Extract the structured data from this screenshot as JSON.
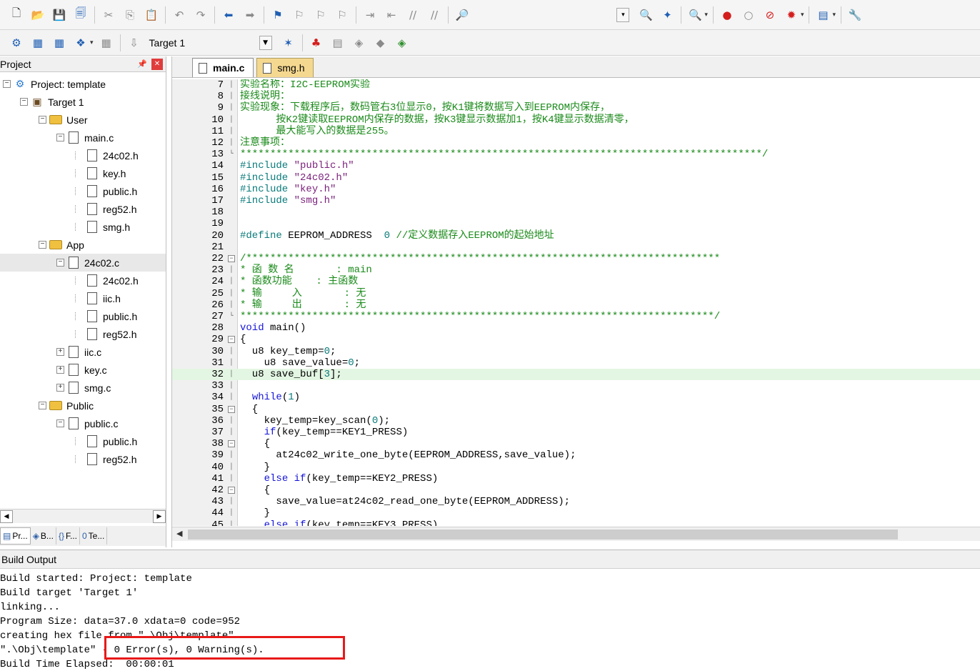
{
  "toolbar1": {
    "items": [
      {
        "name": "new-file-icon",
        "glyph": "🗋",
        "cls": ""
      },
      {
        "name": "open-file-icon",
        "glyph": "📂",
        "cls": "ico-brown"
      },
      {
        "name": "save-icon",
        "glyph": "💾",
        "cls": "ico-blue"
      },
      {
        "name": "save-all-icon",
        "glyph": "🗐",
        "cls": "ico-blue"
      },
      {
        "sep": true
      },
      {
        "name": "cut-icon",
        "glyph": "✂",
        "cls": "ico-gray"
      },
      {
        "name": "copy-icon",
        "glyph": "⎘",
        "cls": "ico-gray"
      },
      {
        "name": "paste-icon",
        "glyph": "📋",
        "cls": ""
      },
      {
        "sep": true
      },
      {
        "name": "undo-icon",
        "glyph": "↶",
        "cls": "ico-gray"
      },
      {
        "name": "redo-icon",
        "glyph": "↷",
        "cls": "ico-gray"
      },
      {
        "sep": true
      },
      {
        "name": "navigate-back-icon",
        "glyph": "⬅",
        "cls": "ico-blue"
      },
      {
        "name": "navigate-forward-icon",
        "glyph": "➡",
        "cls": "ico-gray"
      },
      {
        "sep": true
      },
      {
        "name": "bookmark-icon",
        "glyph": "⚑",
        "cls": "ico-blue"
      },
      {
        "name": "bookmark-prev-icon",
        "glyph": "⚐",
        "cls": "ico-gray"
      },
      {
        "name": "bookmark-next-icon",
        "glyph": "⚐",
        "cls": "ico-gray"
      },
      {
        "name": "bookmark-clear-icon",
        "glyph": "⚐",
        "cls": "ico-gray"
      },
      {
        "sep": true
      },
      {
        "name": "indent-icon",
        "glyph": "⇥",
        "cls": "ico-gray"
      },
      {
        "name": "unindent-icon",
        "glyph": "⇤",
        "cls": "ico-gray"
      },
      {
        "name": "comment-icon",
        "glyph": "//",
        "cls": "ico-gray"
      },
      {
        "name": "uncomment-icon",
        "glyph": "//",
        "cls": "ico-gray"
      },
      {
        "sep": true
      },
      {
        "name": "find-in-files-icon",
        "glyph": "🔎",
        "cls": "ico-brown"
      }
    ],
    "right_items": [
      {
        "name": "find-combo-dropdown-icon",
        "glyph": "▾",
        "cls": "combo"
      },
      {
        "name": "find-icon",
        "glyph": "🔍",
        "cls": "ico-blue"
      },
      {
        "name": "incremental-find-icon",
        "glyph": "✦",
        "cls": "ico-blue"
      },
      {
        "sep": true
      },
      {
        "name": "debug-start-icon",
        "glyph": "🔍",
        "cls": "ico-red",
        "dd": true
      },
      {
        "sep": true
      },
      {
        "name": "breakpoint-insert-icon",
        "glyph": "●",
        "cls": "ico-red"
      },
      {
        "name": "breakpoint-disable-icon",
        "glyph": "○",
        "cls": "ico-gray"
      },
      {
        "name": "breakpoint-kill-all-icon",
        "glyph": "⊘",
        "cls": "ico-red"
      },
      {
        "name": "breakpoint-options-icon",
        "glyph": "✹",
        "cls": "ico-red",
        "dd": true
      },
      {
        "sep": true
      },
      {
        "name": "window-layout-icon",
        "glyph": "▤",
        "cls": "ico-blue",
        "dd": true
      },
      {
        "sep": true
      },
      {
        "name": "configuration-wrench-icon",
        "glyph": "🔧",
        "cls": "ico-gray"
      }
    ]
  },
  "toolbar2": {
    "left_items": [
      {
        "name": "translate-icon",
        "glyph": "⚙",
        "cls": "ico-blue"
      },
      {
        "name": "build-icon",
        "glyph": "▦",
        "cls": "ico-blue"
      },
      {
        "name": "rebuild-icon",
        "glyph": "▦",
        "cls": "ico-blue"
      },
      {
        "name": "batch-build-icon",
        "glyph": "❖",
        "cls": "ico-blue",
        "dd": true
      },
      {
        "name": "stop-build-icon",
        "glyph": "▦",
        "cls": "ico-gray"
      },
      {
        "sep": true
      },
      {
        "name": "download-icon",
        "glyph": "⇩",
        "cls": "ico-gray"
      }
    ],
    "target": "Target 1",
    "right_items": [
      {
        "name": "target-options-icon",
        "glyph": "✶",
        "cls": "ico-blue"
      },
      {
        "sep": true
      },
      {
        "name": "manage-project-items-icon",
        "glyph": "♣",
        "cls": "ico-red"
      },
      {
        "name": "select-packs-icon",
        "glyph": "▤",
        "cls": "ico-gray"
      },
      {
        "name": "manage-rte-icon",
        "glyph": "◈",
        "cls": "ico-gray"
      },
      {
        "name": "pack-installer-icon",
        "glyph": "◆",
        "cls": "ico-gray"
      },
      {
        "name": "run-time-environment-icon",
        "glyph": "◈",
        "cls": "ico-green"
      }
    ]
  },
  "project_panel": {
    "title": "Project",
    "tree": [
      {
        "label": "Project: template",
        "level": 0,
        "exp": "⊟",
        "icon": "proj"
      },
      {
        "label": "Target 1",
        "level": 1,
        "exp": "⊟",
        "icon": "target"
      },
      {
        "label": "User",
        "level": 2,
        "exp": "⊟",
        "icon": "folder"
      },
      {
        "label": "main.c",
        "level": 3,
        "exp": "⊟",
        "icon": "file"
      },
      {
        "label": "24c02.h",
        "level": 4,
        "exp": "",
        "icon": "file"
      },
      {
        "label": "key.h",
        "level": 4,
        "exp": "",
        "icon": "file"
      },
      {
        "label": "public.h",
        "level": 4,
        "exp": "",
        "icon": "file"
      },
      {
        "label": "reg52.h",
        "level": 4,
        "exp": "",
        "icon": "file"
      },
      {
        "label": "smg.h",
        "level": 4,
        "exp": "",
        "icon": "file"
      },
      {
        "label": "App",
        "level": 2,
        "exp": "⊟",
        "icon": "folder"
      },
      {
        "label": "24c02.c",
        "level": 3,
        "exp": "⊟",
        "icon": "file",
        "selected": true
      },
      {
        "label": "24c02.h",
        "level": 4,
        "exp": "",
        "icon": "file"
      },
      {
        "label": "iic.h",
        "level": 4,
        "exp": "",
        "icon": "file"
      },
      {
        "label": "public.h",
        "level": 4,
        "exp": "",
        "icon": "file"
      },
      {
        "label": "reg52.h",
        "level": 4,
        "exp": "",
        "icon": "file"
      },
      {
        "label": "iic.c",
        "level": 3,
        "exp": "⊞",
        "icon": "file"
      },
      {
        "label": "key.c",
        "level": 3,
        "exp": "⊞",
        "icon": "file"
      },
      {
        "label": "smg.c",
        "level": 3,
        "exp": "⊞",
        "icon": "file"
      },
      {
        "label": "Public",
        "level": 2,
        "exp": "⊟",
        "icon": "folder"
      },
      {
        "label": "public.c",
        "level": 3,
        "exp": "⊟",
        "icon": "file"
      },
      {
        "label": "public.h",
        "level": 4,
        "exp": "",
        "icon": "file"
      },
      {
        "label": "reg52.h",
        "level": 4,
        "exp": "",
        "icon": "file"
      }
    ],
    "tabs": [
      {
        "label": "Pr...",
        "icon": "▤",
        "name": "tab-project"
      },
      {
        "label": "B...",
        "icon": "◈",
        "name": "tab-books"
      },
      {
        "label": "F...",
        "icon": "{}",
        "name": "tab-functions"
      },
      {
        "label": "Te...",
        "icon": "0",
        "name": "tab-templates"
      }
    ]
  },
  "editor": {
    "tabs": [
      {
        "label": "main.c",
        "active": true
      },
      {
        "label": "smg.h",
        "active": false
      }
    ],
    "lines": [
      {
        "n": "7",
        "fold": "│",
        "segs": [
          {
            "t": "实验名称：I2C-EEPROM实验",
            "c": "green"
          }
        ]
      },
      {
        "n": "8",
        "fold": "│",
        "segs": [
          {
            "t": "接线说明：",
            "c": "green"
          }
        ]
      },
      {
        "n": "9",
        "fold": "│",
        "segs": [
          {
            "t": "实验现象：下载程序后，数码管右3位显示0，按K1键将数据写入到EEPROM内保存，",
            "c": "green"
          }
        ]
      },
      {
        "n": "10",
        "fold": "│",
        "segs": [
          {
            "t": "      按K2键读取EEPROM内保存的数据，按K3键显示数据加1，按K4键显示数据清零，",
            "c": "green"
          }
        ]
      },
      {
        "n": "11",
        "fold": "│",
        "segs": [
          {
            "t": "      最大能写入的数据是255。",
            "c": "green"
          }
        ]
      },
      {
        "n": "12",
        "fold": "│",
        "segs": [
          {
            "t": "注意事项：",
            "c": "green"
          }
        ]
      },
      {
        "n": "13",
        "fold": "└",
        "segs": [
          {
            "t": "***************************************************************************************/",
            "c": "green"
          }
        ]
      },
      {
        "n": "14",
        "fold": "",
        "segs": [
          {
            "t": "#include ",
            "c": "teal"
          },
          {
            "t": "\"public.h\"",
            "c": "purple"
          }
        ]
      },
      {
        "n": "15",
        "fold": "",
        "segs": [
          {
            "t": "#include ",
            "c": "teal"
          },
          {
            "t": "\"24c02.h\"",
            "c": "purple"
          }
        ]
      },
      {
        "n": "16",
        "fold": "",
        "segs": [
          {
            "t": "#include ",
            "c": "teal"
          },
          {
            "t": "\"key.h\"",
            "c": "purple"
          }
        ]
      },
      {
        "n": "17",
        "fold": "",
        "segs": [
          {
            "t": "#include ",
            "c": "teal"
          },
          {
            "t": "\"smg.h\"",
            "c": "purple"
          }
        ]
      },
      {
        "n": "18",
        "fold": "",
        "segs": []
      },
      {
        "n": "19",
        "fold": "",
        "segs": []
      },
      {
        "n": "20",
        "fold": "",
        "segs": [
          {
            "t": "#define ",
            "c": "teal"
          },
          {
            "t": "EEPROM_ADDRESS  ",
            "c": ""
          },
          {
            "t": "0 ",
            "c": "teal"
          },
          {
            "t": "//定义数据存入EEPROM的起始地址",
            "c": "green"
          }
        ]
      },
      {
        "n": "21",
        "fold": "",
        "segs": []
      },
      {
        "n": "22",
        "fold": "⊟",
        "segs": [
          {
            "t": "/*******************************************************************************",
            "c": "green"
          }
        ]
      },
      {
        "n": "23",
        "fold": "│",
        "segs": [
          {
            "t": "* 函 数 名       : main",
            "c": "green"
          }
        ]
      },
      {
        "n": "24",
        "fold": "│",
        "segs": [
          {
            "t": "* 函数功能    : 主函数",
            "c": "green"
          }
        ]
      },
      {
        "n": "25",
        "fold": "│",
        "segs": [
          {
            "t": "* 输     入       : 无",
            "c": "green"
          }
        ]
      },
      {
        "n": "26",
        "fold": "│",
        "segs": [
          {
            "t": "* 输     出       : 无",
            "c": "green"
          }
        ]
      },
      {
        "n": "27",
        "fold": "└",
        "segs": [
          {
            "t": "*******************************************************************************/",
            "c": "green"
          }
        ]
      },
      {
        "n": "28",
        "fold": "",
        "segs": [
          {
            "t": "void ",
            "c": "blue"
          },
          {
            "t": "main()",
            "c": ""
          }
        ]
      },
      {
        "n": "29",
        "fold": "⊟",
        "segs": [
          {
            "t": "{",
            "c": ""
          }
        ]
      },
      {
        "n": "30",
        "fold": "│",
        "segs": [
          {
            "t": "  u8 key_temp=",
            "c": ""
          },
          {
            "t": "0",
            "c": "teal"
          },
          {
            "t": ";",
            "c": ""
          }
        ]
      },
      {
        "n": "31",
        "fold": "│",
        "segs": [
          {
            "t": "    u8 save_value=",
            "c": ""
          },
          {
            "t": "0",
            "c": "teal"
          },
          {
            "t": ";",
            "c": ""
          }
        ]
      },
      {
        "n": "32",
        "fold": "│",
        "hl": true,
        "segs": [
          {
            "t": "  u8 save_buf[",
            "c": ""
          },
          {
            "t": "3",
            "c": "teal"
          },
          {
            "t": "];",
            "c": ""
          }
        ]
      },
      {
        "n": "33",
        "fold": "│",
        "segs": []
      },
      {
        "n": "34",
        "fold": "│",
        "segs": [
          {
            "t": "  ",
            "c": ""
          },
          {
            "t": "while",
            "c": "blue"
          },
          {
            "t": "(",
            "c": ""
          },
          {
            "t": "1",
            "c": "teal"
          },
          {
            "t": ")",
            "c": ""
          }
        ]
      },
      {
        "n": "35",
        "fold": "⊟",
        "segs": [
          {
            "t": "  {",
            "c": ""
          }
        ]
      },
      {
        "n": "36",
        "fold": "│",
        "segs": [
          {
            "t": "    key_temp=key_scan(",
            "c": ""
          },
          {
            "t": "0",
            "c": "teal"
          },
          {
            "t": ");",
            "c": ""
          }
        ]
      },
      {
        "n": "37",
        "fold": "│",
        "segs": [
          {
            "t": "    ",
            "c": ""
          },
          {
            "t": "if",
            "c": "blue"
          },
          {
            "t": "(key_temp==KEY1_PRESS)",
            "c": ""
          }
        ]
      },
      {
        "n": "38",
        "fold": "⊟",
        "segs": [
          {
            "t": "    {",
            "c": ""
          }
        ]
      },
      {
        "n": "39",
        "fold": "│",
        "segs": [
          {
            "t": "      at24c02_write_one_byte(EEPROM_ADDRESS,save_value);",
            "c": ""
          }
        ]
      },
      {
        "n": "40",
        "fold": "│",
        "segs": [
          {
            "t": "    }",
            "c": ""
          }
        ]
      },
      {
        "n": "41",
        "fold": "│",
        "segs": [
          {
            "t": "    ",
            "c": ""
          },
          {
            "t": "else if",
            "c": "blue"
          },
          {
            "t": "(key_temp==KEY2_PRESS)",
            "c": ""
          }
        ]
      },
      {
        "n": "42",
        "fold": "⊟",
        "segs": [
          {
            "t": "    {",
            "c": ""
          }
        ]
      },
      {
        "n": "43",
        "fold": "│",
        "segs": [
          {
            "t": "      save_value=at24c02_read_one_byte(EEPROM_ADDRESS);",
            "c": ""
          }
        ]
      },
      {
        "n": "44",
        "fold": "│",
        "segs": [
          {
            "t": "    }",
            "c": ""
          }
        ]
      },
      {
        "n": "45",
        "fold": "│",
        "segs": [
          {
            "t": "    ",
            "c": ""
          },
          {
            "t": "else if",
            "c": "blue"
          },
          {
            "t": "(key_temp==KEY3_PRESS)",
            "c": ""
          }
        ]
      }
    ]
  },
  "build_output": {
    "title": "Build Output",
    "lines": [
      "Build started: Project: template",
      "Build target 'Target 1'",
      "linking...",
      "Program Size: data=37.0 xdata=0 code=952",
      "creating hex file from \".\\Obj\\template\"...",
      "\".\\Obj\\template\" - 0 Error(s), 0 Warning(s).",
      "Build Time Elapsed:  00:00:01"
    ]
  },
  "colors": {
    "comment": "#1a8a1a",
    "keyword": "#1515d8",
    "number": "#0a7a7a",
    "string": "#7a1f7a",
    "highlight_line": "#e3f6e3",
    "error_box": "#e81919",
    "active_tab_inactive_bg": "#f5d890"
  }
}
